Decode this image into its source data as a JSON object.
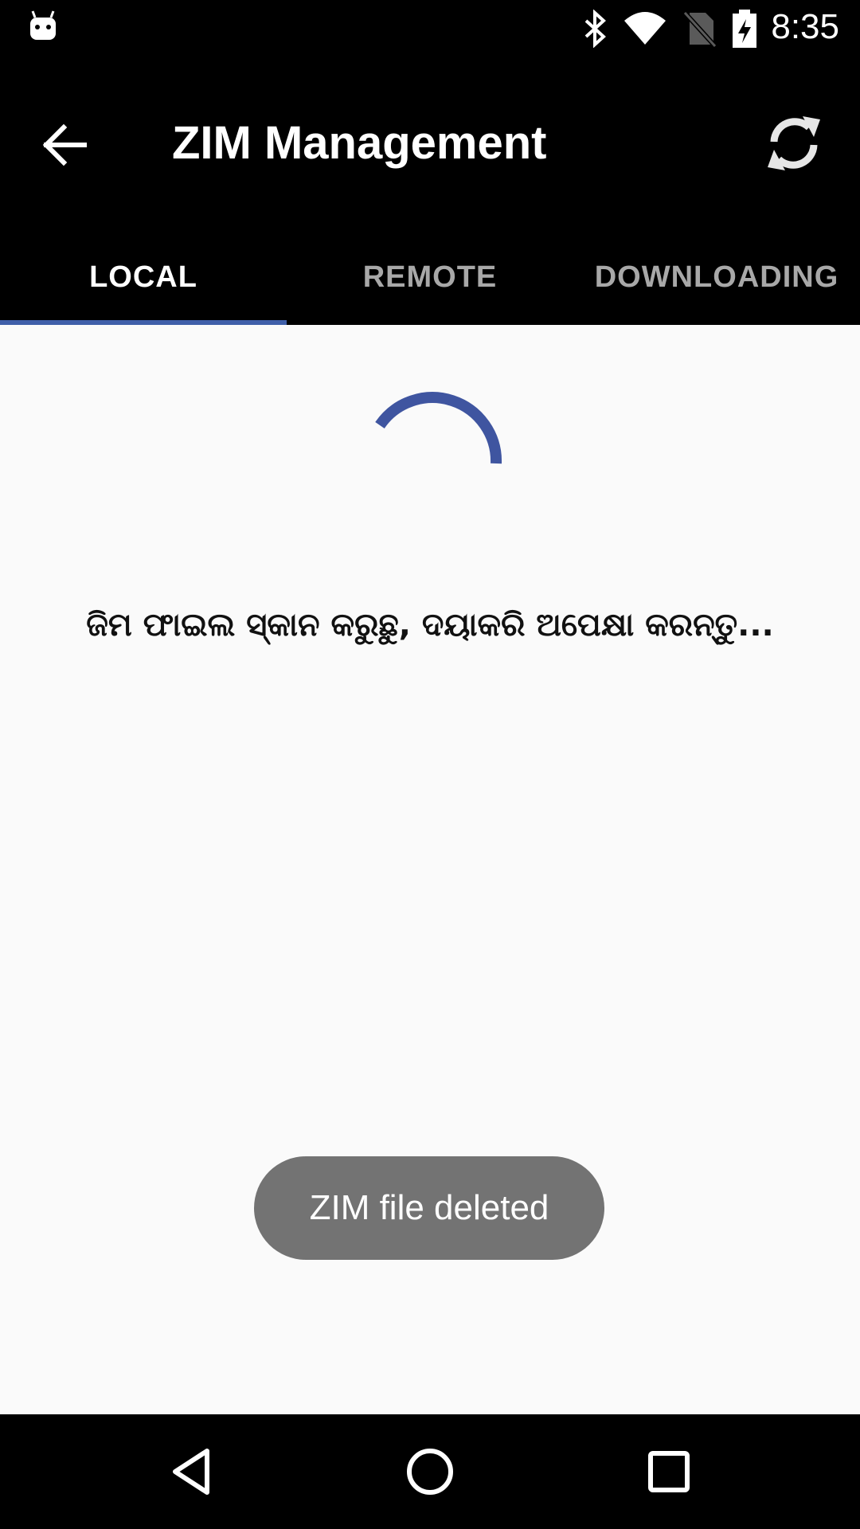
{
  "status_bar": {
    "time": "8:35",
    "icons": [
      "android-debug-icon",
      "bluetooth-icon",
      "wifi-icon",
      "no-sim-icon",
      "battery-charging-icon"
    ]
  },
  "toolbar": {
    "title": "ZIM Management",
    "back_icon": "arrow-back-icon",
    "refresh_icon": "refresh-icon"
  },
  "tabs": [
    {
      "label": "LOCAL",
      "active": true
    },
    {
      "label": "REMOTE",
      "active": false
    },
    {
      "label": "DOWNLOADING",
      "active": false
    }
  ],
  "content": {
    "message": "ଜିମ ଫାଇଲ ସ୍କାନ କରୁଛୁ, ଦୟାକରି ଅପେକ୍ଷା କରନ୍ତୁ..."
  },
  "toast": {
    "text": "ZIM file deleted"
  },
  "nav_bar": {
    "icons": [
      "back-triangle-icon",
      "home-circle-icon",
      "recents-square-icon"
    ]
  },
  "colors": {
    "accent": "#3f5fa9",
    "toolbar_bg": "#000000",
    "content_bg": "#fafafa",
    "toast_bg": "#737373"
  }
}
